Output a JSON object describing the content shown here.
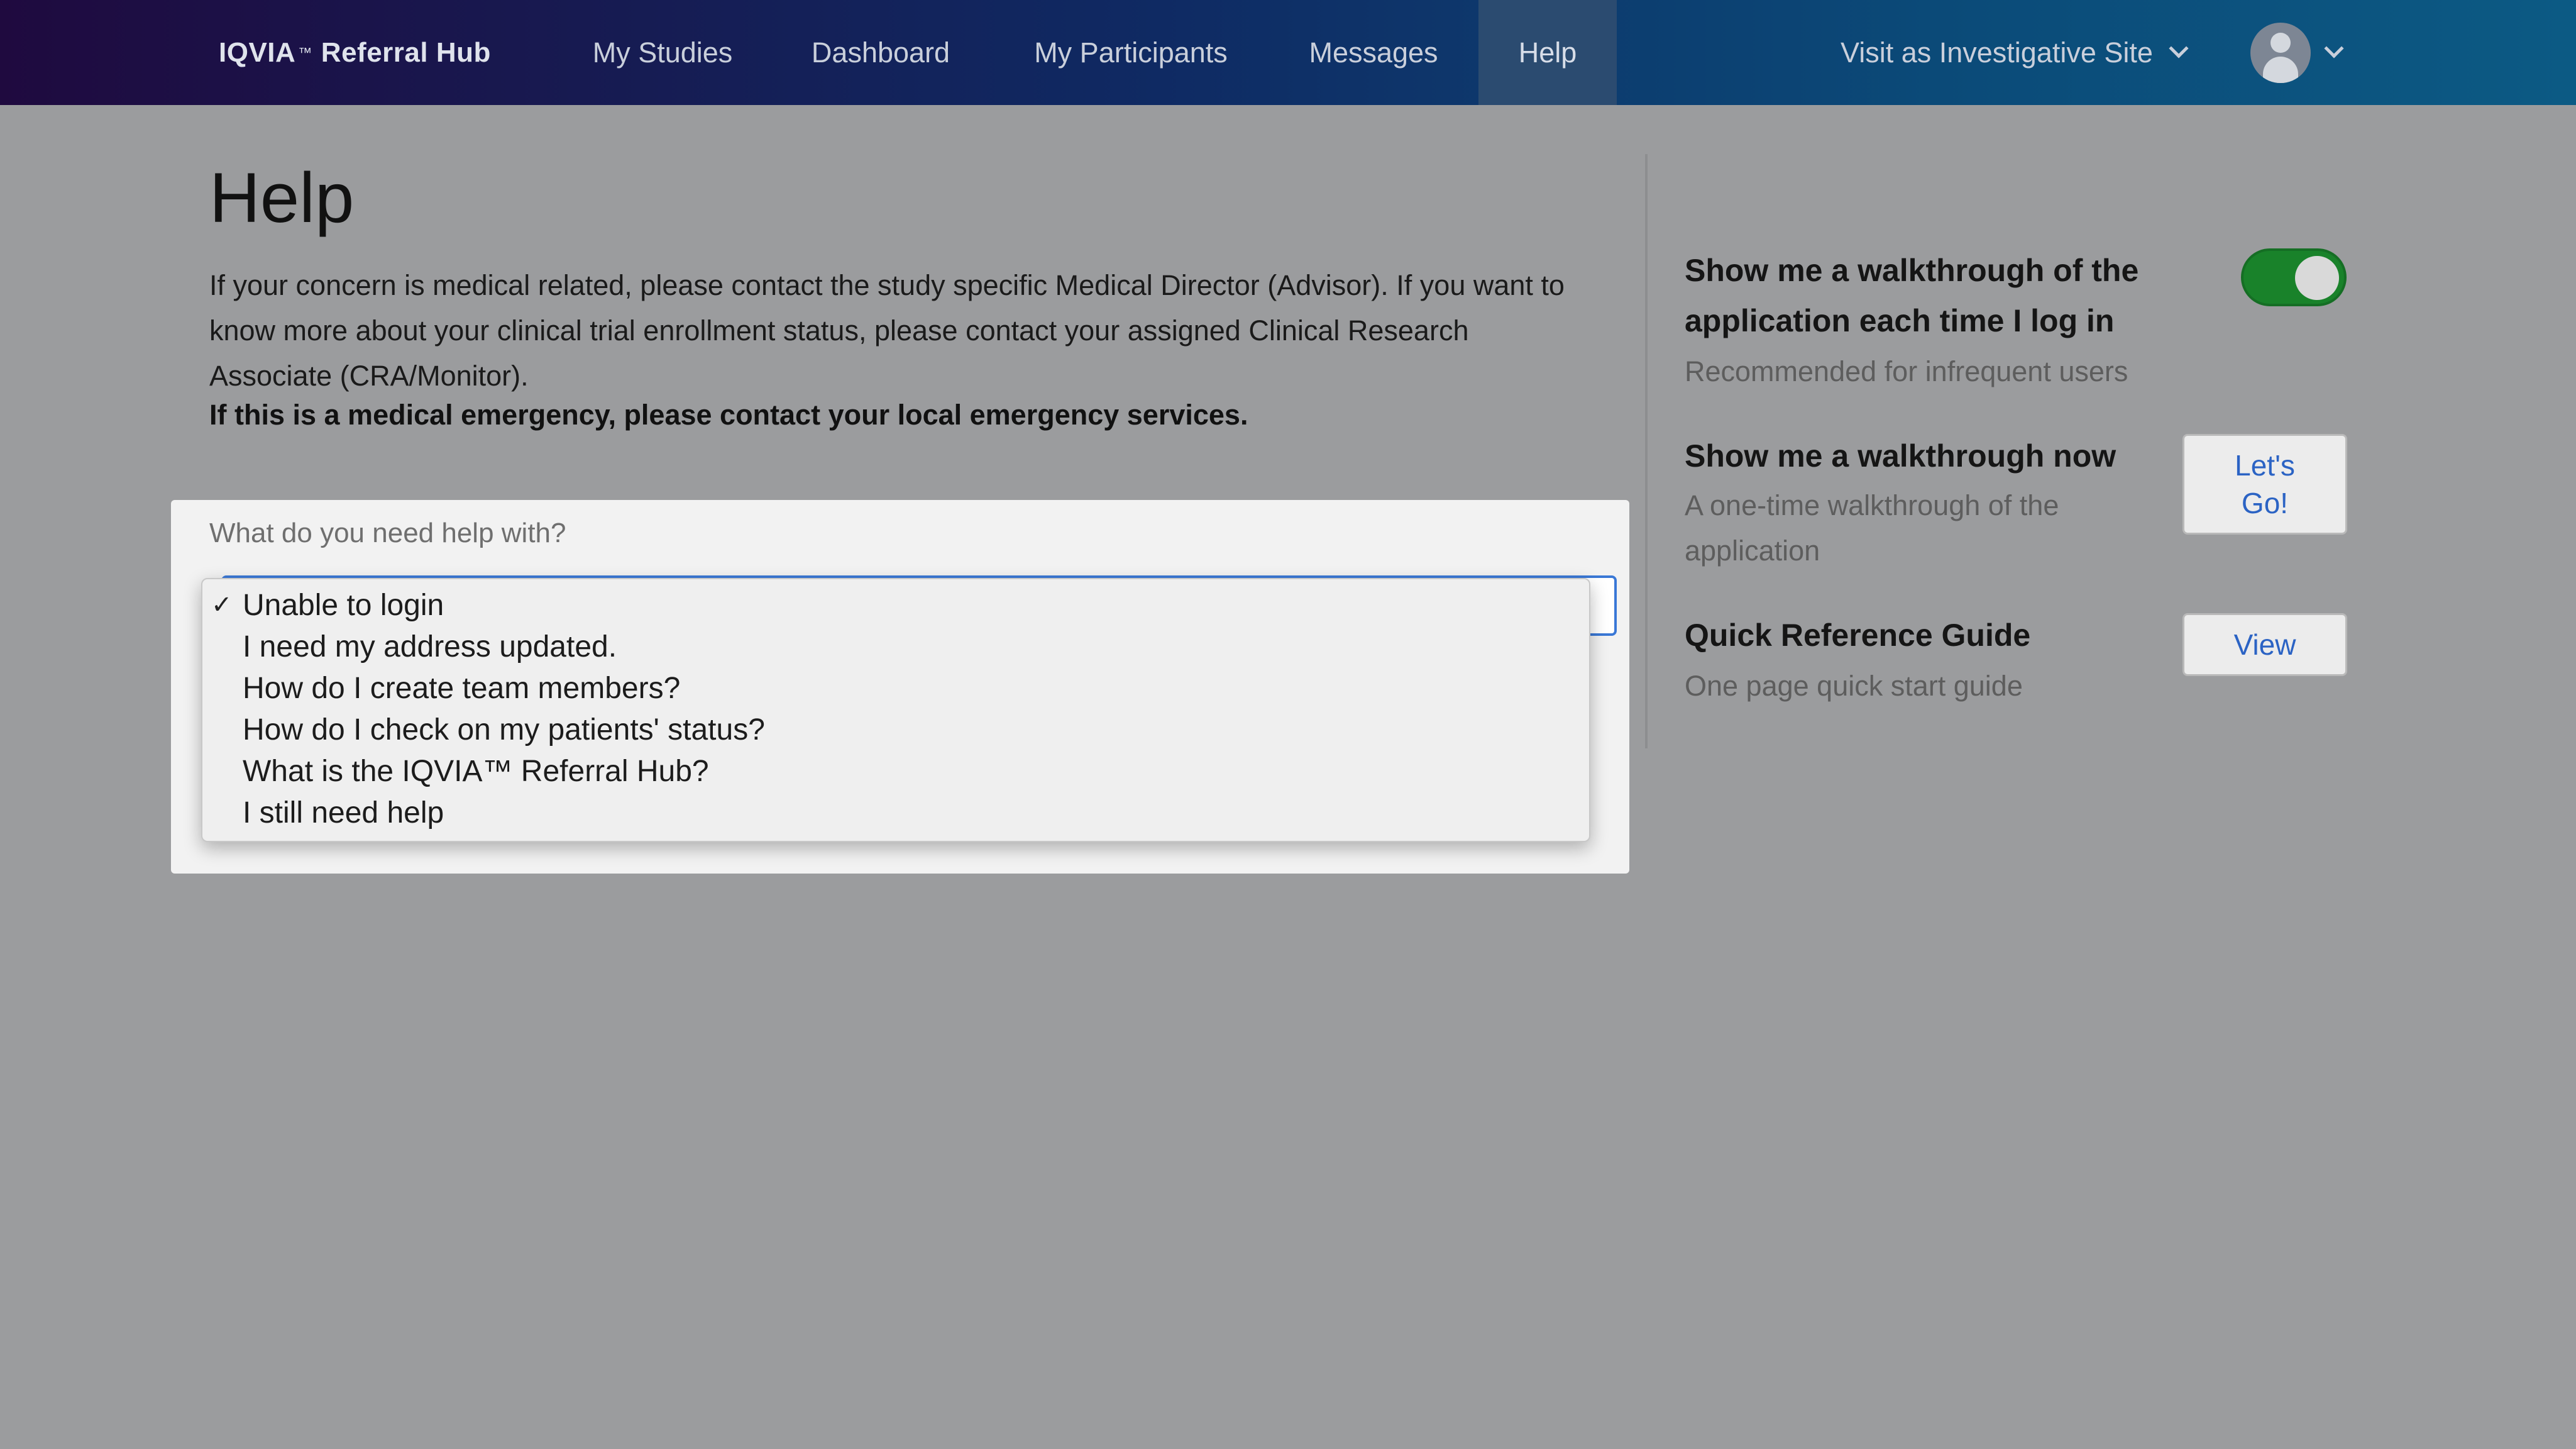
{
  "header": {
    "brand_name": "IQVIA",
    "brand_tm": "™",
    "brand_suffix": "Referral Hub",
    "nav": [
      {
        "label": "My Studies"
      },
      {
        "label": "Dashboard"
      },
      {
        "label": "My Participants"
      },
      {
        "label": "Messages"
      },
      {
        "label": "Help",
        "active": true
      }
    ],
    "visit_site": "Visit as Investigative Site",
    "avatar_icon": "user-avatar-icon"
  },
  "main": {
    "title": "Help",
    "intro": "If your concern is medical related, please contact the study specific Medical Director (Advisor). If you want to know more about your clinical trial enrollment status, please contact your assigned Clinical Research Associate (CRA/Monitor).",
    "warning": "If this is a medical emergency, please contact your local emergency services.",
    "help_select": {
      "label": "What do you need help with?",
      "selected": "Unable to login",
      "options": [
        "Unable to login",
        "I need my address updated.",
        "How do I create team members?",
        "How do I check on my patients' status?",
        "What is the IQVIA™ Referral Hub?",
        "I still need help"
      ]
    }
  },
  "sidebar": {
    "walkthrough_login": {
      "title": "Show me a walkthrough of the application each time I log in",
      "subtitle": "Recommended for infrequent users",
      "enabled": true
    },
    "walkthrough_now": {
      "title": "Show me a walkthrough now",
      "subtitle": "A one-time walkthrough of the application",
      "button": "Let's Go!"
    },
    "quick_ref": {
      "title": "Quick Reference Guide",
      "subtitle": "One page quick start guide",
      "button": "View"
    }
  },
  "colors": {
    "toggle_on": "#19822a",
    "link_blue": "#2b63c4",
    "focus_border": "#3a78d6"
  }
}
